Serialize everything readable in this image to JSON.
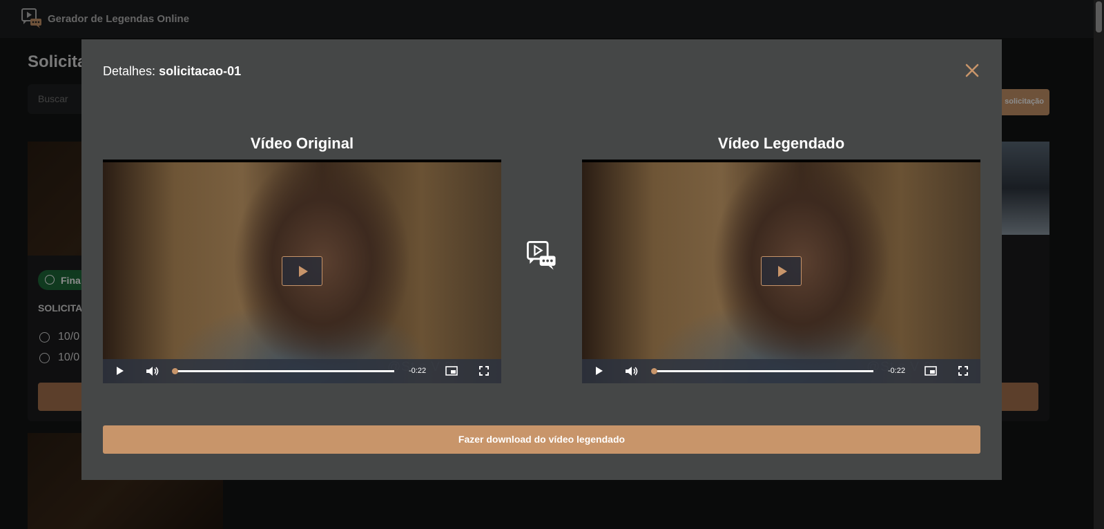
{
  "app": {
    "title": "Gerador de Legendas Online"
  },
  "background_page": {
    "heading": "Solicitaç",
    "search_placeholder": "Buscar",
    "new_request_label": "solicitação",
    "card": {
      "status": "Fina",
      "title": "SOLICITAÇ",
      "created": "10/0",
      "updated": "10/0"
    }
  },
  "modal": {
    "header_prefix": "Detalhes:",
    "header_name": "solicitacao-01",
    "original_title": "Vídeo Original",
    "subtitled_title": "Vídeo Legendado",
    "original_video": {
      "time": "-0:22",
      "progress": 0.0
    },
    "subtitled_video": {
      "time": "-0:22",
      "progress": 0.0
    },
    "download_label": "Fazer download do vídeo legendado"
  },
  "colors": {
    "accent": "#c8956a",
    "modal_bg": "#454747",
    "page_bg": "#131415",
    "status_green": "#1e6a3a"
  },
  "icons": {
    "brand": "subtitle-video-icon",
    "close": "close-icon",
    "center": "subtitle-video-icon"
  }
}
